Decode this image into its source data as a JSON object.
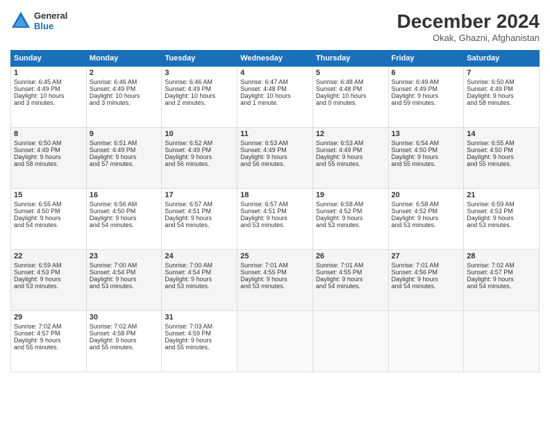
{
  "header": {
    "logo_general": "General",
    "logo_blue": "Blue",
    "month_title": "December 2024",
    "location": "Okak, Ghazni, Afghanistan"
  },
  "days_of_week": [
    "Sunday",
    "Monday",
    "Tuesday",
    "Wednesday",
    "Thursday",
    "Friday",
    "Saturday"
  ],
  "weeks": [
    [
      {
        "day": "1",
        "info": "Sunrise: 6:45 AM\nSunset: 4:49 PM\nDaylight: 10 hours\nand 3 minutes."
      },
      {
        "day": "2",
        "info": "Sunrise: 6:46 AM\nSunset: 4:49 PM\nDaylight: 10 hours\nand 3 minutes."
      },
      {
        "day": "3",
        "info": "Sunrise: 6:46 AM\nSunset: 4:49 PM\nDaylight: 10 hours\nand 2 minutes."
      },
      {
        "day": "4",
        "info": "Sunrise: 6:47 AM\nSunset: 4:48 PM\nDaylight: 10 hours\nand 1 minute."
      },
      {
        "day": "5",
        "info": "Sunrise: 6:48 AM\nSunset: 4:48 PM\nDaylight: 10 hours\nand 0 minutes."
      },
      {
        "day": "6",
        "info": "Sunrise: 6:49 AM\nSunset: 4:49 PM\nDaylight: 9 hours\nand 59 minutes."
      },
      {
        "day": "7",
        "info": "Sunrise: 6:50 AM\nSunset: 4:49 PM\nDaylight: 9 hours\nand 58 minutes."
      }
    ],
    [
      {
        "day": "8",
        "info": "Sunrise: 6:50 AM\nSunset: 4:49 PM\nDaylight: 9 hours\nand 58 minutes."
      },
      {
        "day": "9",
        "info": "Sunrise: 6:51 AM\nSunset: 4:49 PM\nDaylight: 9 hours\nand 57 minutes."
      },
      {
        "day": "10",
        "info": "Sunrise: 6:52 AM\nSunset: 4:49 PM\nDaylight: 9 hours\nand 56 minutes."
      },
      {
        "day": "11",
        "info": "Sunrise: 6:53 AM\nSunset: 4:49 PM\nDaylight: 9 hours\nand 56 minutes."
      },
      {
        "day": "12",
        "info": "Sunrise: 6:53 AM\nSunset: 4:49 PM\nDaylight: 9 hours\nand 55 minutes."
      },
      {
        "day": "13",
        "info": "Sunrise: 6:54 AM\nSunset: 4:50 PM\nDaylight: 9 hours\nand 55 minutes."
      },
      {
        "day": "14",
        "info": "Sunrise: 6:55 AM\nSunset: 4:50 PM\nDaylight: 9 hours\nand 55 minutes."
      }
    ],
    [
      {
        "day": "15",
        "info": "Sunrise: 6:55 AM\nSunset: 4:50 PM\nDaylight: 9 hours\nand 54 minutes."
      },
      {
        "day": "16",
        "info": "Sunrise: 6:56 AM\nSunset: 4:50 PM\nDaylight: 9 hours\nand 54 minutes."
      },
      {
        "day": "17",
        "info": "Sunrise: 6:57 AM\nSunset: 4:51 PM\nDaylight: 9 hours\nand 54 minutes."
      },
      {
        "day": "18",
        "info": "Sunrise: 6:57 AM\nSunset: 4:51 PM\nDaylight: 9 hours\nand 53 minutes."
      },
      {
        "day": "19",
        "info": "Sunrise: 6:58 AM\nSunset: 4:52 PM\nDaylight: 9 hours\nand 53 minutes."
      },
      {
        "day": "20",
        "info": "Sunrise: 6:58 AM\nSunset: 4:52 PM\nDaylight: 9 hours\nand 53 minutes."
      },
      {
        "day": "21",
        "info": "Sunrise: 6:59 AM\nSunset: 4:53 PM\nDaylight: 9 hours\nand 53 minutes."
      }
    ],
    [
      {
        "day": "22",
        "info": "Sunrise: 6:59 AM\nSunset: 4:53 PM\nDaylight: 9 hours\nand 53 minutes."
      },
      {
        "day": "23",
        "info": "Sunrise: 7:00 AM\nSunset: 4:54 PM\nDaylight: 9 hours\nand 53 minutes."
      },
      {
        "day": "24",
        "info": "Sunrise: 7:00 AM\nSunset: 4:54 PM\nDaylight: 9 hours\nand 53 minutes."
      },
      {
        "day": "25",
        "info": "Sunrise: 7:01 AM\nSunset: 4:55 PM\nDaylight: 9 hours\nand 53 minutes."
      },
      {
        "day": "26",
        "info": "Sunrise: 7:01 AM\nSunset: 4:55 PM\nDaylight: 9 hours\nand 54 minutes."
      },
      {
        "day": "27",
        "info": "Sunrise: 7:01 AM\nSunset: 4:56 PM\nDaylight: 9 hours\nand 54 minutes."
      },
      {
        "day": "28",
        "info": "Sunrise: 7:02 AM\nSunset: 4:57 PM\nDaylight: 9 hours\nand 54 minutes."
      }
    ],
    [
      {
        "day": "29",
        "info": "Sunrise: 7:02 AM\nSunset: 4:57 PM\nDaylight: 9 hours\nand 55 minutes."
      },
      {
        "day": "30",
        "info": "Sunrise: 7:02 AM\nSunset: 4:58 PM\nDaylight: 9 hours\nand 55 minutes."
      },
      {
        "day": "31",
        "info": "Sunrise: 7:03 AM\nSunset: 4:59 PM\nDaylight: 9 hours\nand 55 minutes."
      },
      {
        "day": "",
        "info": ""
      },
      {
        "day": "",
        "info": ""
      },
      {
        "day": "",
        "info": ""
      },
      {
        "day": "",
        "info": ""
      }
    ]
  ]
}
